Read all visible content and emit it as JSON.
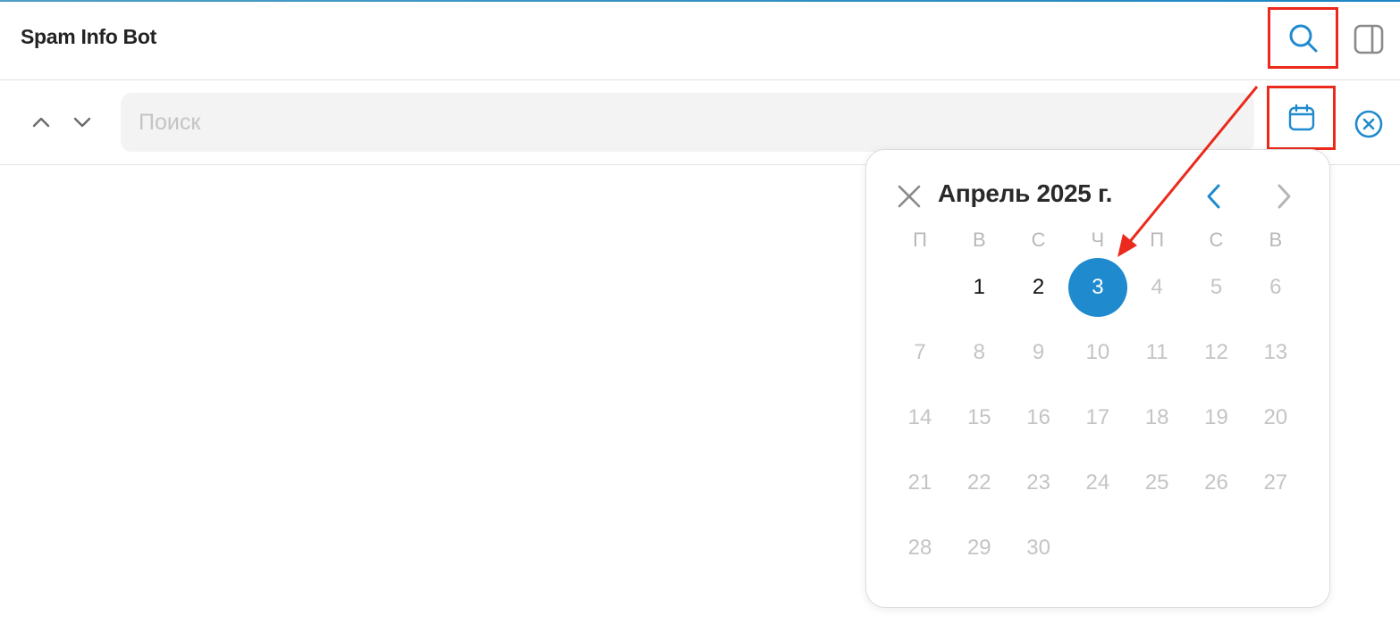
{
  "header": {
    "title": "Spam Info Bot",
    "search_icon": "search-icon",
    "panel_icon": "sidebar-panel-icon"
  },
  "search": {
    "placeholder": "Поиск",
    "value": "",
    "up_icon": "chevron-up-icon",
    "down_icon": "chevron-down-icon",
    "calendar_icon": "calendar-icon",
    "clear_icon": "close-circle-icon"
  },
  "datepicker": {
    "month_title": "Апрель 2025 г.",
    "weekdays": [
      "П",
      "В",
      "С",
      "Ч",
      "П",
      "С",
      "В"
    ],
    "days": [
      {
        "label": "1",
        "enabled": true
      },
      {
        "label": "2",
        "enabled": true
      },
      {
        "label": "3",
        "enabled": true,
        "selected": true
      },
      {
        "label": "4"
      },
      {
        "label": "5"
      },
      {
        "label": "6"
      },
      {
        "label": "7"
      },
      {
        "label": "8"
      },
      {
        "label": "9"
      },
      {
        "label": "10"
      },
      {
        "label": "11"
      },
      {
        "label": "12"
      },
      {
        "label": "13"
      },
      {
        "label": "14"
      },
      {
        "label": "15"
      },
      {
        "label": "16"
      },
      {
        "label": "17"
      },
      {
        "label": "18"
      },
      {
        "label": "19"
      },
      {
        "label": "20"
      },
      {
        "label": "21"
      },
      {
        "label": "22"
      },
      {
        "label": "23"
      },
      {
        "label": "24"
      },
      {
        "label": "25"
      },
      {
        "label": "26"
      },
      {
        "label": "27"
      },
      {
        "label": "28"
      },
      {
        "label": "29"
      },
      {
        "label": "30"
      }
    ],
    "selected_day": "3",
    "first_weekday_index": 1
  },
  "colors": {
    "accent": "#1f8ace",
    "annotation": "#ea2a1c",
    "disabled_text": "#c4c4c4"
  }
}
